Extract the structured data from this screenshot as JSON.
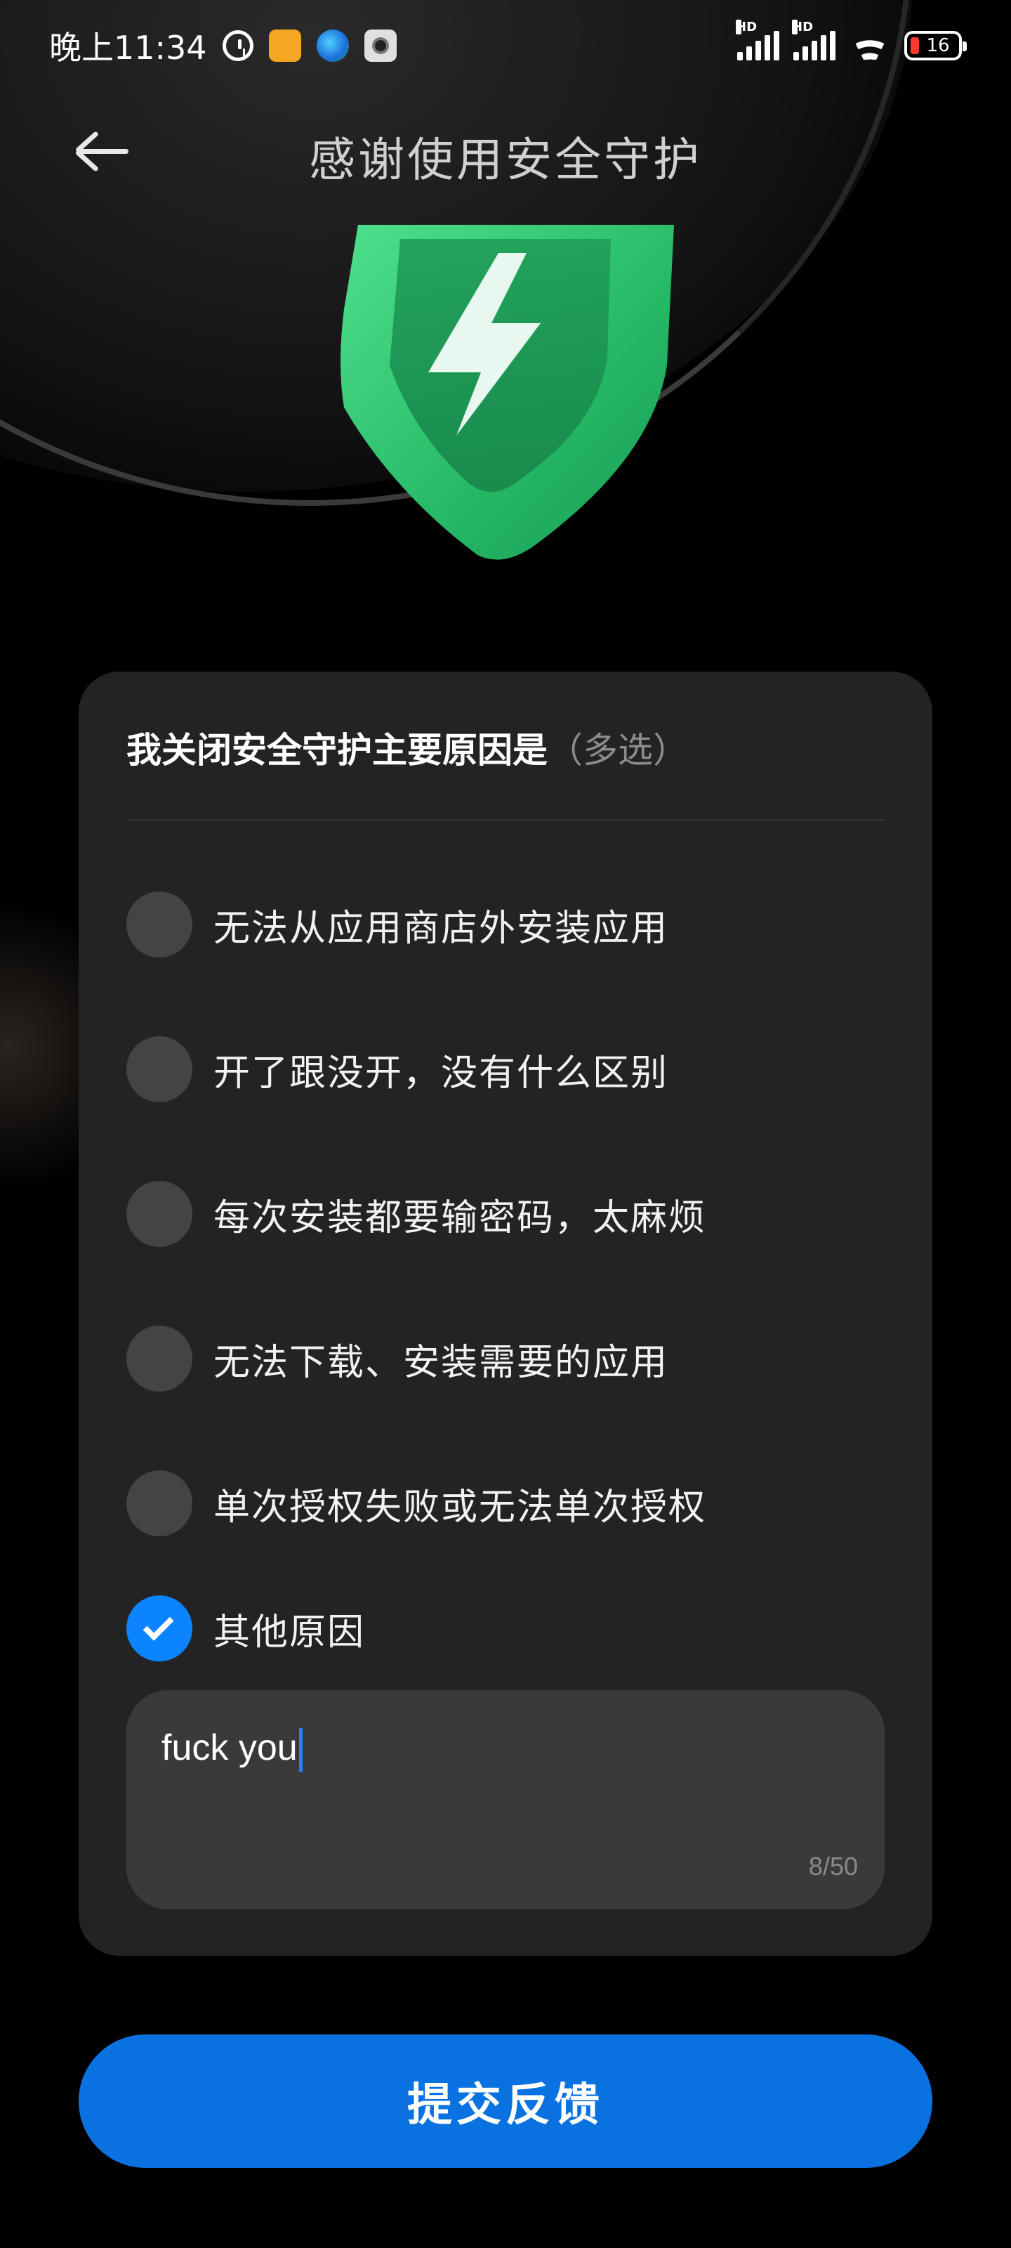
{
  "status_bar": {
    "time": "晚上11:34",
    "network_label_1": "HD",
    "network_label_2": "HD",
    "battery_level": "16",
    "icons": [
      "alarm-icon",
      "notes-app-icon",
      "edge-browser-icon",
      "camera-app-icon",
      "signal-icon",
      "signal-icon",
      "wifi-icon",
      "battery-icon"
    ]
  },
  "header": {
    "title": "感谢使用安全守护",
    "back_icon": "back-arrow-icon"
  },
  "illustration": {
    "icon": "shield-lightning-icon",
    "color": "#2fbf6f"
  },
  "survey": {
    "title": "我关闭安全守护主要原因是",
    "hint": "（多选）",
    "options": [
      {
        "label": "无法从应用商店外安装应用",
        "checked": false
      },
      {
        "label": "开了跟没开，没有什么区别",
        "checked": false
      },
      {
        "label": "每次安装都要输密码，太麻烦",
        "checked": false
      },
      {
        "label": "无法下载、安装需要的应用",
        "checked": false
      },
      {
        "label": "单次授权失败或无法单次授权",
        "checked": false
      },
      {
        "label": "其他原因",
        "checked": true
      }
    ],
    "other_reason": {
      "value": "fuck you",
      "counter": "8/50"
    }
  },
  "submit": {
    "label": "提交反馈"
  },
  "colors": {
    "accent": "#0a72e0",
    "checked": "#0d84ff",
    "card": "#232323",
    "input": "#3a3a3c"
  }
}
